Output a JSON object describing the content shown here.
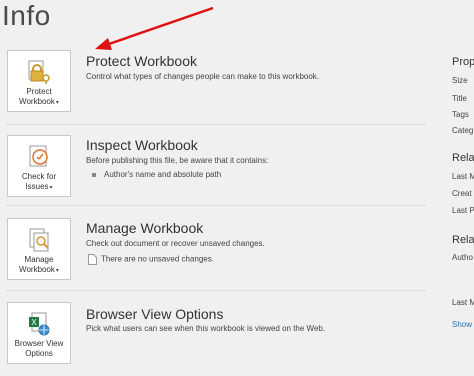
{
  "page": {
    "title": "Info"
  },
  "sections": [
    {
      "id": "protect",
      "button_label": "Protect\nWorkbook",
      "button_icon": "padlock-key-icon",
      "title": "Protect Workbook",
      "description": "Control what types of changes people can make to this workbook.",
      "bullets": []
    },
    {
      "id": "inspect",
      "button_label": "Check for\nIssues",
      "button_icon": "document-check-icon",
      "title": "Inspect Workbook",
      "description": "Before publishing this file, be aware that it contains:",
      "bullets": [
        "Author's name and absolute path"
      ]
    },
    {
      "id": "manage",
      "button_label": "Manage\nWorkbook",
      "button_icon": "document-search-icon",
      "title": "Manage Workbook",
      "description": "Check out document or recover unsaved changes.",
      "bullets": [
        "There are no unsaved changes."
      ]
    },
    {
      "id": "browser",
      "button_label": "Browser View\nOptions",
      "button_icon": "excel-globe-icon",
      "title": "Browser View Options",
      "description": "Pick what users can see when this workbook is viewed on the Web.",
      "bullets": []
    }
  ],
  "right_panel": {
    "properties_head": "Prop",
    "property_rows": [
      "Size",
      "Title",
      "Tags",
      "Categ"
    ],
    "related_dates_head": "Rela",
    "date_rows": [
      "Last M",
      "Creat",
      "Last P"
    ],
    "related_people_head": "Rela",
    "people_rows": [
      "Autho"
    ],
    "last_modified_by": "Last M",
    "show_link": "Show"
  },
  "colors": {
    "background": "#f0f0f0",
    "arrow": "#e01010",
    "link": "#2b6db0"
  }
}
